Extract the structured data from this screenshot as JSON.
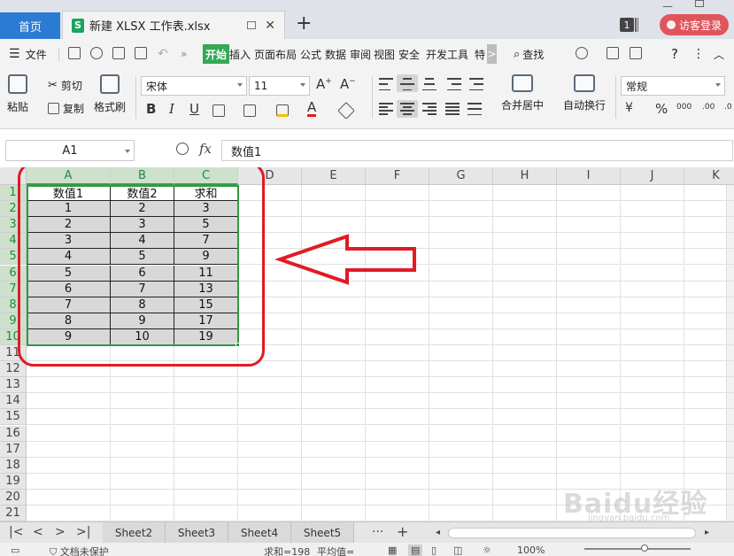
{
  "tabbar": {
    "home_tab": "首页",
    "doc_tab": "新建 XLSX 工作表.xlsx",
    "doc_icon_letter": "S",
    "new_tab_label": "+",
    "window_count": "1",
    "login_label": "访客登录"
  },
  "menu": {
    "file": "文件",
    "items": [
      "开始",
      "插入",
      "页面布局",
      "公式",
      "数据",
      "审阅",
      "视图",
      "安全",
      "开发工具",
      "特"
    ],
    "more": ">",
    "search": "查找"
  },
  "toolbar": {
    "paste": "粘贴",
    "cut": "剪切",
    "copy": "复制",
    "format_painter": "格式刷",
    "font_name": "宋体",
    "font_size": "11",
    "bold": "B",
    "italic": "I",
    "underline": "U",
    "font_color_letter": "A",
    "merge_center": "合并居中",
    "wrap_text": "自动换行",
    "number_format": "常规",
    "percent": "%",
    "grow_font": "A",
    "shrink_font": "A"
  },
  "formula_bar": {
    "cell_ref": "A1",
    "fx": "fx",
    "content": "数值1"
  },
  "sheet": {
    "columns": [
      "A",
      "B",
      "C",
      "D",
      "E",
      "F",
      "G",
      "H",
      "I",
      "J",
      "K"
    ],
    "rows": [
      "1",
      "2",
      "3",
      "4",
      "5",
      "6",
      "7",
      "8",
      "9",
      "10",
      "11",
      "12",
      "13",
      "14",
      "15",
      "16",
      "17",
      "18",
      "19",
      "20",
      "21"
    ],
    "table": {
      "headers": [
        "数值1",
        "数值2",
        "求和"
      ],
      "data": [
        [
          "1",
          "2",
          "3"
        ],
        [
          "2",
          "3",
          "5"
        ],
        [
          "3",
          "4",
          "7"
        ],
        [
          "4",
          "5",
          "9"
        ],
        [
          "5",
          "6",
          "11"
        ],
        [
          "6",
          "7",
          "13"
        ],
        [
          "7",
          "8",
          "15"
        ],
        [
          "8",
          "9",
          "17"
        ],
        [
          "9",
          "10",
          "19"
        ]
      ]
    }
  },
  "sheet_tabs": {
    "nav": [
      "|<",
      "<",
      ">",
      ">|"
    ],
    "tabs": [
      "Sheet2",
      "Sheet3",
      "Sheet4",
      "Sheet5"
    ],
    "more": "···",
    "add": "+"
  },
  "status": {
    "doc_protect": "文档未保护",
    "sum": "求和=198",
    "avg": "平均值=",
    "zoom": "100%"
  },
  "watermark": {
    "main": "Baidu经验",
    "sub": "jingyan.baidu.com"
  },
  "colors": {
    "accent_blue": "#2b7bd4",
    "active_green": "#34a853",
    "selection_green": "#2f9a3f",
    "annotation_red": "#e01b24",
    "login_red": "#e0555c"
  }
}
